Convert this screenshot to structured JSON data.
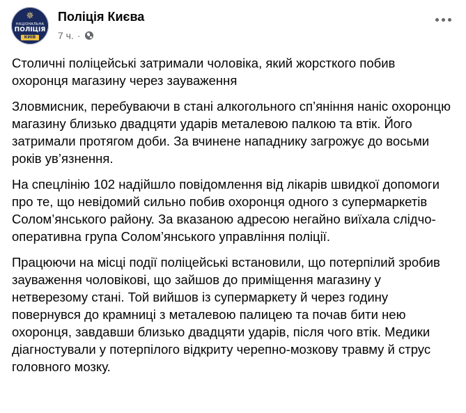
{
  "page": {
    "name": "Поліція Києва",
    "time": "7 ч.",
    "separator": "·",
    "privacy_icon": "globe-icon",
    "more_icon": "more-options-icon"
  },
  "avatar": {
    "line1": "НАЦІОНАЛЬНА",
    "line2": "ПОЛІЦІЯ",
    "line3": "КИЇВ",
    "colors": {
      "background": "#1a2a5e",
      "accent": "#f0c040"
    }
  },
  "post": {
    "paragraphs": [
      "Столичні поліцейські затримали чоловіка, який жорсткого побив охоронця магазину через зауваження",
      "Зловмисник, перебуваючи в стані алкогольного сп’яніння наніс охоронцю магазину близько двадцяти ударів металевою палкою та втік. Його затримали протягом доби. За вчинене нападнику загрожує до восьми років ув’язнення.",
      "На спецлінію 102 надійшло повідомлення від лікарів швидкої допомоги про те, що невідомий сильно побив охоронця одного з супермаркетів Солом’янського району. За вказаною адресою негайно виїхала слідчо-оперативна група Солом’янського управління поліції.",
      "Працюючи на місці події поліцейські встановили, що  потерпілий зробив зауваження чоловікові, що зайшов до приміщення магазину у нетверезому стані. Той вийшов із супермаркету й через годину повернувся до крамниці з металевою палицею та почав бити нею охоронця, завдавши близько двадцяти ударів, після чого втік. Медики діагностували у потерпілого відкриту черепно-мозкову травму й струс головного мозку."
    ]
  }
}
